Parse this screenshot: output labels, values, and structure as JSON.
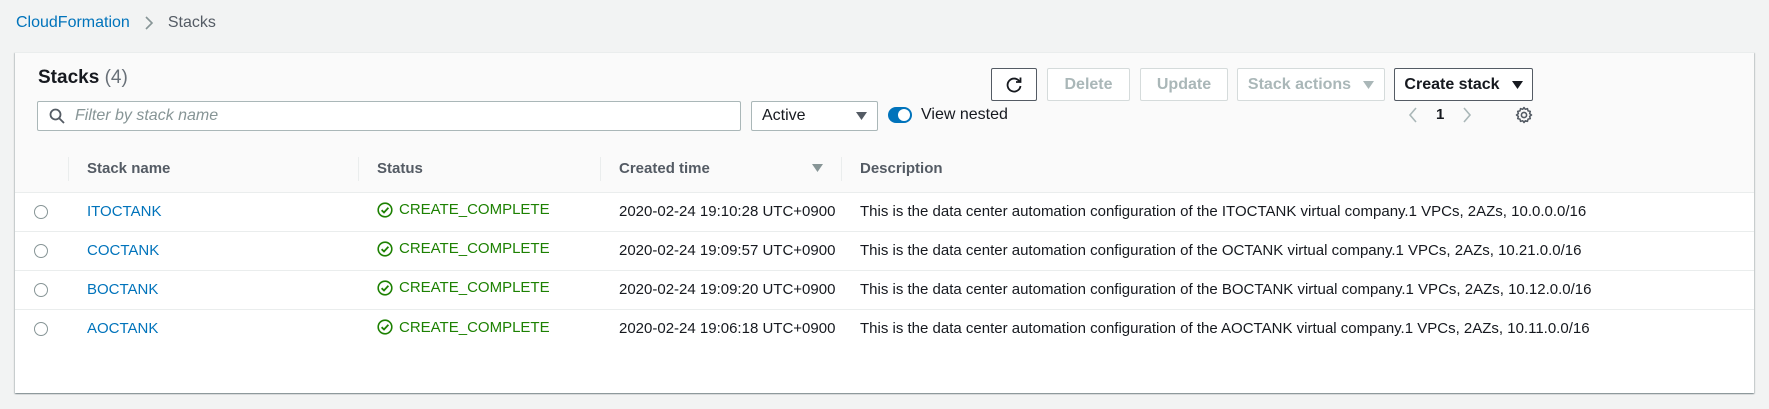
{
  "breadcrumb": {
    "root": "CloudFormation",
    "current": "Stacks"
  },
  "panel": {
    "title": "Stacks",
    "count": "(4)"
  },
  "toolbar": {
    "refresh_icon": "refresh-icon",
    "delete_label": "Delete",
    "update_label": "Update",
    "stack_actions_label": "Stack actions",
    "create_stack_label": "Create stack"
  },
  "filter": {
    "placeholder": "Filter by stack name",
    "value": ""
  },
  "status_filter": {
    "selected": "Active"
  },
  "view_nested": {
    "label": "View nested",
    "enabled": true
  },
  "pagination": {
    "current_page": "1"
  },
  "table": {
    "columns": [
      "Stack name",
      "Status",
      "Created time",
      "Description"
    ],
    "rows": [
      {
        "name": "ITOCTANK",
        "status": "CREATE_COMPLETE",
        "created": "2020-02-24 19:10:28 UTC+0900",
        "description": "This is the data center automation configuration of the ITOCTANK virtual company.1 VPCs, 2AZs, 10.0.0.0/16"
      },
      {
        "name": "COCTANK",
        "status": "CREATE_COMPLETE",
        "created": "2020-02-24 19:09:57 UTC+0900",
        "description": "This is the data center automation configuration of the OCTANK virtual company.1 VPCs, 2AZs, 10.21.0.0/16"
      },
      {
        "name": "BOCTANK",
        "status": "CREATE_COMPLETE",
        "created": "2020-02-24 19:09:20 UTC+0900",
        "description": "This is the data center automation configuration of the BOCTANK virtual company.1 VPCs, 2AZs, 10.12.0.0/16"
      },
      {
        "name": "AOCTANK",
        "status": "CREATE_COMPLETE",
        "created": "2020-02-24 19:06:18 UTC+0900",
        "description": "This is the data center automation configuration of the AOCTANK virtual company.1 VPCs, 2AZs, 10.11.0.0/16"
      }
    ]
  },
  "colors": {
    "link": "#0073bb",
    "success": "#1d8102",
    "background": "#f2f3f3"
  }
}
